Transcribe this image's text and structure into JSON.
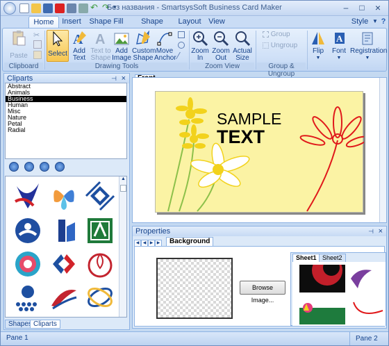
{
  "window": {
    "title": "Без названия - SmartsysSoft Business Card Maker",
    "style_label": "Style"
  },
  "ribbon_tabs": [
    "Home",
    "Insert",
    "Shape Fill",
    "Shape Stroke",
    "Layout",
    "View"
  ],
  "ribbon": {
    "paste": "Paste",
    "select": "Select",
    "add_text": [
      "Add",
      "Text"
    ],
    "text_to_shape": [
      "Text to",
      "Shape"
    ],
    "add_image": [
      "Add",
      "Image"
    ],
    "custom_shape": [
      "Custom",
      "Shape"
    ],
    "move_anchor": [
      "Move",
      "Anchor"
    ],
    "zoom_in": [
      "Zoom",
      "In"
    ],
    "zoom_out": [
      "Zoom",
      "Out"
    ],
    "actual_size": [
      "Actual",
      "Size"
    ],
    "group": "Group",
    "ungroup": "Ungroup",
    "flip": "Flip",
    "font": "Font",
    "registration": "Registration",
    "groups": {
      "clipboard": "Clipboard",
      "drawing_tools": "Drawing Tools",
      "zoom_view": "Zoom View",
      "group_ungroup": "Group & Ungroup"
    }
  },
  "cliparts_panel": {
    "title": "Cliparts",
    "categories": [
      "Abstract",
      "Animals",
      "Business",
      "Human",
      "Misc",
      "Nature",
      "Petal",
      "Radial"
    ],
    "selected": "Business",
    "tabs": [
      "Shapes",
      "Cliparts"
    ]
  },
  "canvas": {
    "tab": "Front",
    "card_text_line1": "SAMPLE",
    "card_text_line2": "TEXT"
  },
  "properties": {
    "title": "Properties",
    "tab": "Background",
    "browse_button": "Browse Image...",
    "sheet_tabs": [
      "Sheet1",
      "Sheet2"
    ]
  },
  "status": {
    "left": "Pane 1",
    "right": "Pane 2"
  },
  "colors": {
    "card_bg": "#fbf3a4",
    "flower_yellow": "#f2d21c",
    "flower_red": "#e0191b"
  }
}
